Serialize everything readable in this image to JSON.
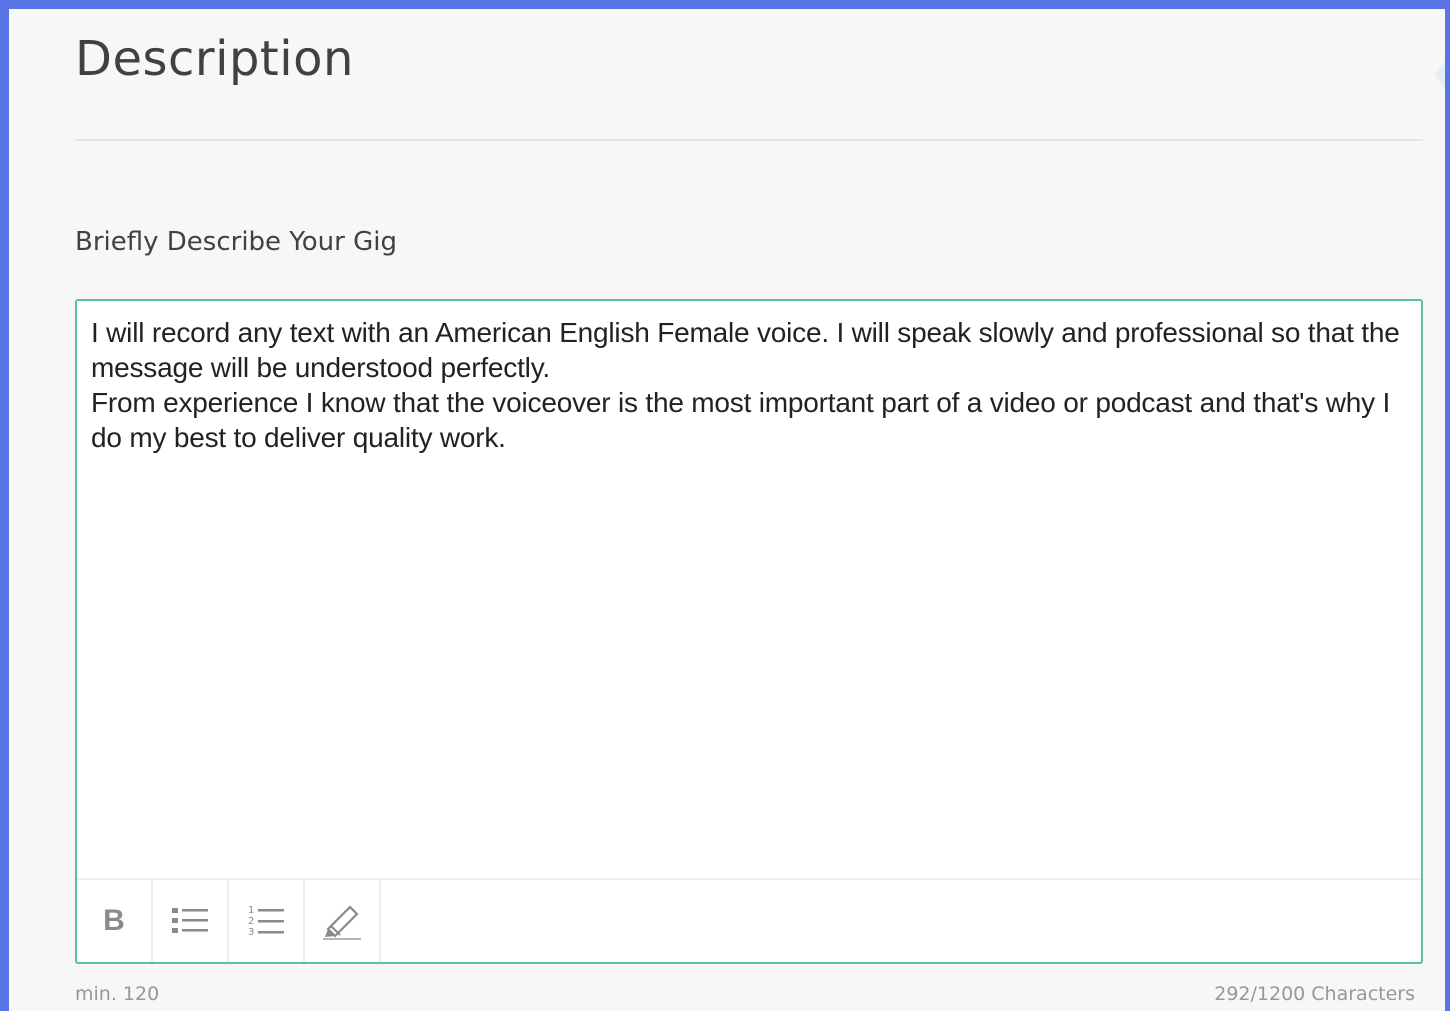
{
  "section": {
    "title": "Description"
  },
  "field": {
    "label": "Briefly Describe Your Gig",
    "value": "I will record any text with an American English Female voice. I will speak slowly and professional so that the message will be understood perfectly.\nFrom experience I know that the voiceover is the most important part of a video or podcast and that's why I do my best to deliver quality work."
  },
  "toolbar": {
    "bold_label": "B",
    "buttons": [
      {
        "icon": "bold-icon"
      },
      {
        "icon": "bulleted-list-icon"
      },
      {
        "icon": "numbered-list-icon"
      },
      {
        "icon": "highlighter-icon"
      }
    ]
  },
  "meta": {
    "min_text": "min. 120",
    "char_count": "292/1200 Characters"
  },
  "colors": {
    "frame_border": "#5a74e6",
    "editor_border": "#5cc1a0",
    "page_bg": "#f7f7f7"
  }
}
